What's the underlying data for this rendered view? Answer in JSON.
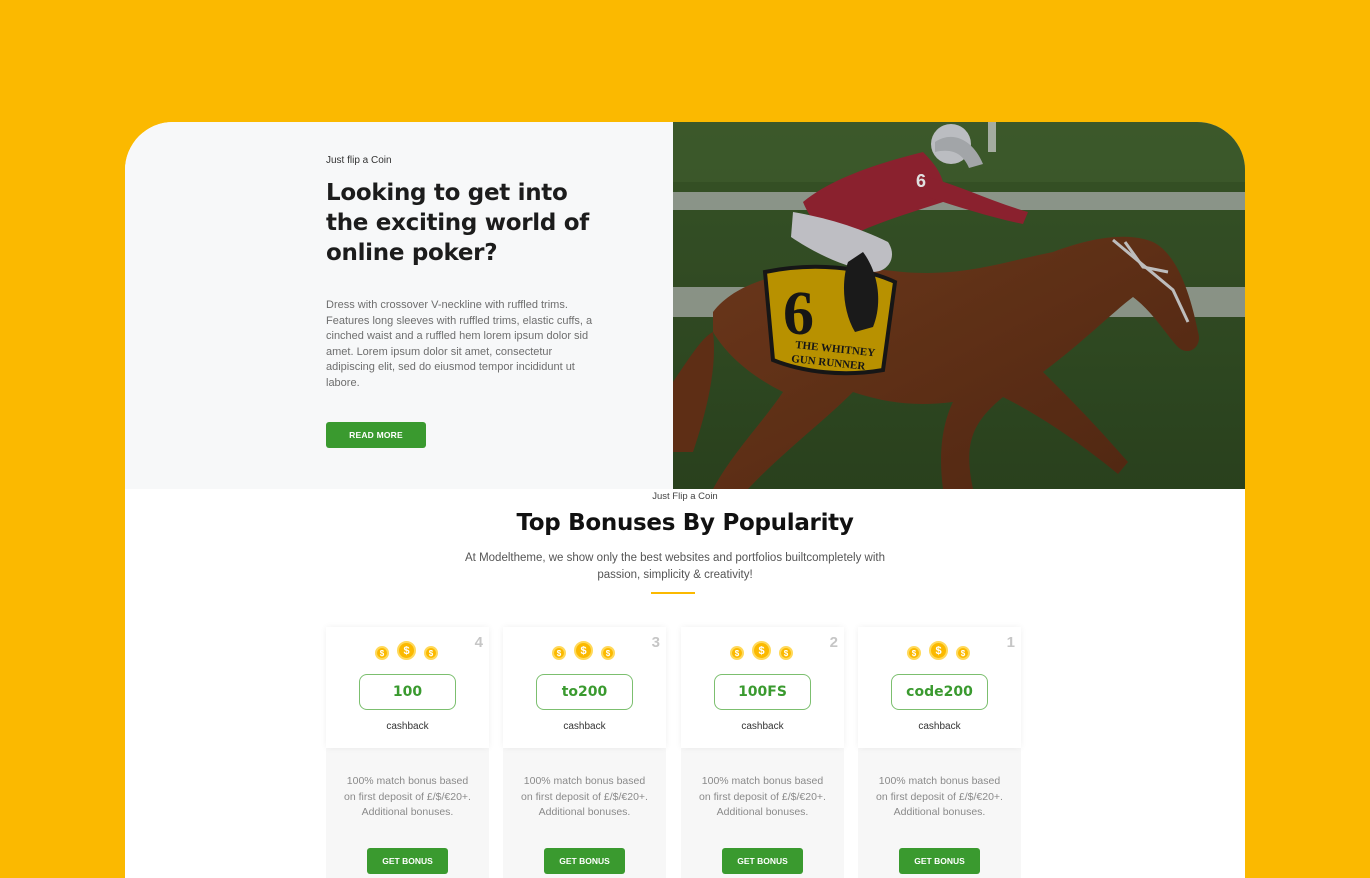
{
  "hero": {
    "eyebrow": "Just flip a Coin",
    "title": "Looking to get into the exciting world of online poker?",
    "body": "Dress with crossover V-neckline with ruffled trims. Features long sleeves with ruffled trims, elastic cuffs, a cinched waist and a ruffled hem lorem ipsum dolor sid amet. Lorem ipsum dolor sit amet, consectetur adipiscing elit, sed do eiusmod tempor incididunt ut labore.",
    "button_label": "READ MORE",
    "image_alt": "Jockey racing a horse",
    "saddle_cloth": {
      "number": "6",
      "line1": "THE WHITNEY",
      "line2": "GUN RUNNER"
    },
    "jockey_number": "6"
  },
  "section": {
    "eyebrow": "Just Flip a Coin",
    "title": "Top Bonuses By Popularity",
    "description": "At Modeltheme, we show only the best websites and portfolios builtcompletely with passion, simplicity & creativity!"
  },
  "bonuses": [
    {
      "rank": "4",
      "code": "100",
      "label": "cashback",
      "text": "100% match bonus based on first deposit of £/$/€20+. Additional bonuses.",
      "button_label": "GET BONUS"
    },
    {
      "rank": "3",
      "code": "to200",
      "label": "cashback",
      "text": "100% match bonus based on first deposit of £/$/€20+. Additional bonuses.",
      "button_label": "GET BONUS"
    },
    {
      "rank": "2",
      "code": "100FS",
      "label": "cashback",
      "text": "100% match bonus based on first deposit of £/$/€20+. Additional bonuses.",
      "button_label": "GET BONUS"
    },
    {
      "rank": "1",
      "code": "code200",
      "label": "cashback",
      "text": "100% match bonus based on first deposit of £/$/€20+. Additional bonuses.",
      "button_label": "GET BONUS"
    }
  ],
  "colors": {
    "background": "#fbb900",
    "accent_green": "#3a9a2f",
    "accent_gold": "#fbb900"
  },
  "icons": {
    "coin": "dollar-coin-icon"
  }
}
